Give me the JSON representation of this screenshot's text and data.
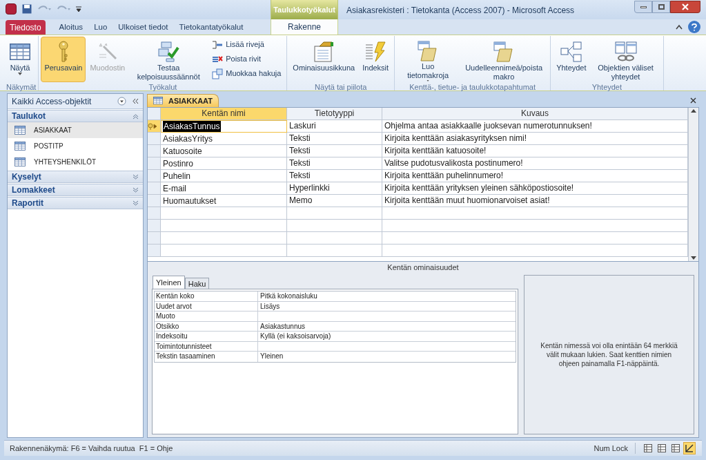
{
  "window": {
    "title": "Asiakasrekisteri : Tietokanta (Access 2007)  -  Microsoft Access",
    "context_group": "Taulukkotyökalut"
  },
  "tabs": [
    {
      "label": "Tiedosto",
      "kind": "file",
      "selected": false
    },
    {
      "label": "Aloitus",
      "kind": "tab",
      "selected": false
    },
    {
      "label": "Luo",
      "kind": "tab",
      "selected": false
    },
    {
      "label": "Ulkoiset tiedot",
      "kind": "tab",
      "selected": false
    },
    {
      "label": "Tietokantatyökalut",
      "kind": "tab",
      "selected": false
    },
    {
      "label": "Rakenne",
      "kind": "context",
      "selected": true
    }
  ],
  "ribbon": {
    "groups": [
      {
        "label": "Näkymät",
        "buttons": [
          {
            "label": "Näytä",
            "kind": "large",
            "dropdown": true,
            "disabled": false,
            "selected": false
          }
        ]
      },
      {
        "label": "Työkalut",
        "buttons": [
          {
            "label": "Perusavain",
            "kind": "large",
            "dropdown": false,
            "disabled": false,
            "selected": true
          },
          {
            "label": "Muodostin",
            "kind": "large",
            "dropdown": false,
            "disabled": true,
            "selected": false
          },
          {
            "label": "Testaa kelpoisuussäännöt",
            "kind": "large",
            "dropdown": false,
            "disabled": false,
            "selected": false
          },
          {
            "label": "Lisää rivejä",
            "kind": "small",
            "dropdown": false,
            "disabled": false,
            "selected": false
          },
          {
            "label": "Poista rivit",
            "kind": "small",
            "dropdown": false,
            "disabled": false,
            "selected": false
          },
          {
            "label": "Muokkaa hakuja",
            "kind": "small",
            "dropdown": false,
            "disabled": false,
            "selected": false
          }
        ]
      },
      {
        "label": "Näytä tai piilota",
        "buttons": [
          {
            "label": "Ominaisuusikkuna",
            "kind": "large",
            "dropdown": false,
            "disabled": false,
            "selected": false
          },
          {
            "label": "Indeksit",
            "kind": "large",
            "dropdown": false,
            "disabled": false,
            "selected": false
          }
        ]
      },
      {
        "label": "Kenttä-, tietue- ja taulukkotapahtumat",
        "buttons": [
          {
            "label": "Luo tietomakroja",
            "kind": "large",
            "dropdown": true,
            "disabled": false,
            "selected": false
          },
          {
            "label": "Uudelleennimeä/poista makro",
            "kind": "large",
            "dropdown": false,
            "disabled": false,
            "selected": false
          }
        ]
      },
      {
        "label": "Yhteydet",
        "buttons": [
          {
            "label": "Yhteydet",
            "kind": "large",
            "dropdown": false,
            "disabled": false,
            "selected": false
          },
          {
            "label": "Objektien väliset yhteydet",
            "kind": "large",
            "dropdown": false,
            "disabled": false,
            "selected": false
          }
        ]
      }
    ]
  },
  "nav": {
    "title": "Kaikki Access-objektit",
    "sections": [
      {
        "label": "Taulukot",
        "expanded": true,
        "items": [
          {
            "label": "ASIAKKAAT",
            "selected": true
          },
          {
            "label": "POSTITP",
            "selected": false
          },
          {
            "label": "YHTEYSHENKILÖT",
            "selected": false
          }
        ]
      },
      {
        "label": "Kyselyt",
        "expanded": false
      },
      {
        "label": "Lomakkeet",
        "expanded": false
      },
      {
        "label": "Raportit",
        "expanded": false
      }
    ]
  },
  "document_tab": "ASIAKKAAT",
  "grid": {
    "columns": [
      "Kentän nimi",
      "Tietotyyppi",
      "Kuvaus"
    ],
    "rows": [
      {
        "name": "AsiakasTunnus",
        "type": "Laskuri",
        "description": "Ohjelma antaa asiakkaalle juoksevan numerotunnuksen!",
        "primary_key": true,
        "selected": true
      },
      {
        "name": "AsiakasYritys",
        "type": "Teksti",
        "description": "Kirjoita kenttään asiakasyrityksen nimi!",
        "primary_key": false,
        "selected": false
      },
      {
        "name": "Katuosoite",
        "type": "Teksti",
        "description": "Kirjoita kenttään katuosoite!",
        "primary_key": false,
        "selected": false
      },
      {
        "name": "Postinro",
        "type": "Teksti",
        "description": "Valitse pudotusvalikosta postinumero!",
        "primary_key": false,
        "selected": false
      },
      {
        "name": "Puhelin",
        "type": "Teksti",
        "description": "Kirjoita kenttään puhelinnumero!",
        "primary_key": false,
        "selected": false
      },
      {
        "name": "E-mail",
        "type": "Hyperlinkki",
        "description": "Kirjoita kenttään yrityksen yleinen sähköpostiosoite!",
        "primary_key": false,
        "selected": false
      },
      {
        "name": "Huomautukset",
        "type": "Memo",
        "description": "Kirjoita kenttään muut huomionarvoiset asiat!",
        "primary_key": false,
        "selected": false
      }
    ]
  },
  "properties": {
    "title": "Kentän ominaisuudet",
    "tabs": [
      {
        "label": "Yleinen",
        "selected": true
      },
      {
        "label": "Haku",
        "selected": false
      }
    ],
    "rows": [
      {
        "label": "Kentän koko",
        "value": "Pitkä kokonaisluku"
      },
      {
        "label": "Uudet arvot",
        "value": "Lisäys"
      },
      {
        "label": "Muoto"
      },
      {
        "label": "Otsikko",
        "value": "Asiakastunnus"
      },
      {
        "label": "Indeksoitu",
        "value": "Kyllä (ei kaksoisarvoja)"
      },
      {
        "label": "Toimintotunnisteet"
      },
      {
        "label": "Tekstin tasaaminen",
        "value": "Yleinen"
      }
    ],
    "help": "Kentän nimessä voi olla enintään 64 merkkiä välit mukaan lukien. Saat kenttien nimien ohjeen painamalla F1-näppäintä."
  },
  "status_bar": {
    "text": "Rakennenäkymä: F6 = Vaihda ruutua  F1 = Ohje",
    "indicator": "Num Lock",
    "views": [
      {
        "selected": false
      },
      {
        "selected": false
      },
      {
        "selected": false
      },
      {
        "selected": true
      }
    ]
  }
}
